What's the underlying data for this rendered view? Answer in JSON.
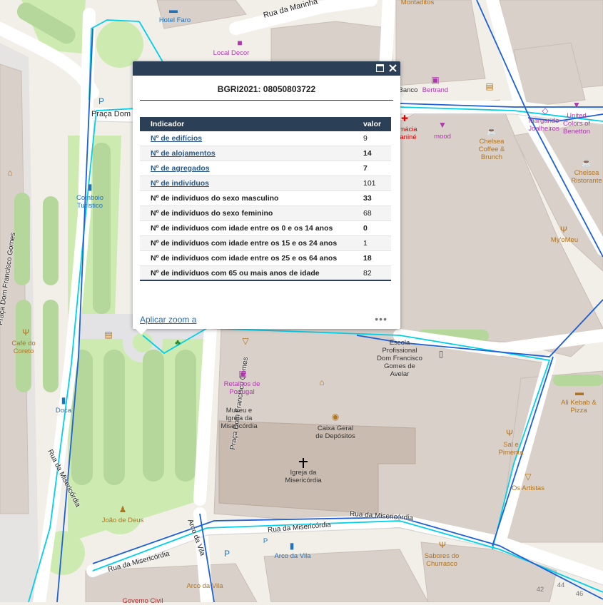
{
  "map": {
    "streets": {
      "rua_da_marinha": "Rua da Marinha",
      "praca_dom": "Praça Dom",
      "praca_dom_francisco_gomes_1": "Praça Dom Francisco Gomes",
      "praca_dom_francisco_gomes_2": "Praça Dom Francisco Gomes",
      "rua_da_misericordia_1": "Rua da Misericórdia",
      "rua_da_misericordia_2": "Rua da Misericórdia",
      "rua_da_misericordia_3": "Rua da Misericórdia",
      "rua_da_misericordia_4": "Rua da Misericórdia",
      "arco_da_vila_street": "Arco da Vila"
    },
    "pois": {
      "hotel_faro": "Hotel Faro",
      "local_decor": "Local Decor",
      "montaditos": "Montaditos",
      "banco": "Banco",
      "bertrand": "Bertrand",
      "farmacia": "mácia\naniné",
      "mood": "mood",
      "chelsea_coffee": "Chelsea\nCoffee &\nBrunch",
      "margarido": "Margarido\nJoalheiros",
      "united_colors": "United\nColors of\nBenetton",
      "chelsea_ristorante": "Chelsea\nRistorante",
      "my_omeu": "My'oMeu",
      "comboio": "Comboio\nTurístico",
      "cafe_coreto": "Café do\nCoreto",
      "doca": "Doca",
      "escola": "Escola\nProfissional\nDom Francisco\nGomes de\nAvelar",
      "retalhos": "Retalhos de\nPortugal",
      "museu": "Museu e\nIgreja da\nMisericórdia",
      "caixa": "Caixa Geral\nde Depósitos",
      "igreja": "Igreja da\nMisericórdia",
      "sal_pimenta": "Sal e\nPimenta",
      "ali_kebab": "Ali Kebab &\nPizza",
      "os_artistas": "Os Artistas",
      "joao_de_deus": "João de Deus",
      "arco_da_vila": "Arco da Vila",
      "arco_da_vila_2": "Arco da Vila",
      "sabores": "Sabores do\nChurrasco",
      "governo_civil": "Governo Civil",
      "p_label": "P"
    },
    "house_numbers": [
      "42",
      "44",
      "46"
    ]
  },
  "popup": {
    "title": "BGRI2021: 08050803722",
    "columns": {
      "indicator": "Indicador",
      "value": "valor"
    },
    "rows": [
      {
        "label": "Nº de edifícios",
        "value": "9",
        "link": true,
        "bold": false
      },
      {
        "label": "Nº de alojamentos",
        "value": "14",
        "link": true,
        "bold": true
      },
      {
        "label": "Nº de agregados",
        "value": "7",
        "link": true,
        "bold": true
      },
      {
        "label": "Nº de indivíduos",
        "value": "101",
        "link": true,
        "bold": false
      },
      {
        "label": "Nº de indivíduos do sexo masculino",
        "value": "33",
        "link": false,
        "bold": true
      },
      {
        "label": "Nº de indivíduos do sexo feminino",
        "value": "68",
        "link": false,
        "bold": false
      },
      {
        "label": "Nº de indivíduos com idade entre os 0 e os 14 anos",
        "value": "0",
        "link": false,
        "bold": true
      },
      {
        "label": "Nº de indivíduos com idade entre os 15 e os 24 anos",
        "value": "1",
        "link": false,
        "bold": false
      },
      {
        "label": "Nº de indivíduos com idade entre os 25 e os 64 anos",
        "value": "18",
        "link": false,
        "bold": true
      },
      {
        "label": "Nº de indivíduos com 65 ou mais anos de idade",
        "value": "82",
        "link": false,
        "bold": false
      }
    ],
    "footer_link": "Aplicar zoom a",
    "more": "•••",
    "colors": {
      "header": "#2b3f57",
      "link": "#2b6cb0"
    }
  },
  "colors": {
    "building": "#d9d0c9",
    "park": "#cdebb0",
    "road": "#ffffff",
    "boundary_cyan": "#00d0e8",
    "boundary_blue": "#1c5fd6"
  }
}
